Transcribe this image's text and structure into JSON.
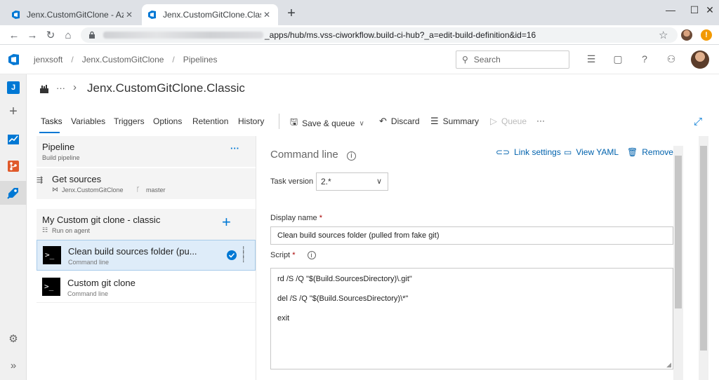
{
  "browser": {
    "tabs": [
      {
        "title": "Jenx.CustomGitClone - Azure De",
        "active": false
      },
      {
        "title": "Jenx.CustomGitClone.Classic - Az",
        "active": true
      }
    ],
    "new_tab": "+",
    "window_controls": {
      "minimize": "—",
      "maximize": "☐",
      "close": "✕"
    },
    "url_path": "_apps/hub/ms.vss-ciworkflow.build-ci-hub?_a=edit-build-definition&id=16",
    "warning_badge": "!"
  },
  "header": {
    "breadcrumbs": [
      "jenxsoft",
      "Jenx.CustomGitClone",
      "Pipelines"
    ],
    "separator": "/",
    "search_placeholder": "Search"
  },
  "rail": {
    "project_initial": "J"
  },
  "page": {
    "title": "Jenx.CustomGitClone.Classic",
    "more": "···",
    "chevron": "›"
  },
  "tabs": [
    "Tasks",
    "Variables",
    "Triggers",
    "Options",
    "Retention",
    "History"
  ],
  "toolbar": {
    "save_queue": "Save & queue",
    "discard": "Discard",
    "summary": "Summary",
    "queue": "Queue",
    "more": "···"
  },
  "pipeline": {
    "title": "Pipeline",
    "subtitle": "Build pipeline",
    "more": "···",
    "get_sources": {
      "title": "Get sources",
      "repo": "Jenx.CustomGitClone",
      "branch": "master"
    },
    "agent_job": {
      "title": "My Custom git clone - classic",
      "subtitle": "Run on agent",
      "add": "+"
    },
    "tasks": [
      {
        "name": "Clean build sources folder (pu...",
        "type": "Command line",
        "selected": true
      },
      {
        "name": "Custom git clone",
        "type": "Command line",
        "selected": false
      }
    ]
  },
  "details": {
    "title": "Command line",
    "links": {
      "link_settings": "Link settings",
      "view_yaml": "View YAML",
      "remove": "Remove"
    },
    "task_version_label": "Task version",
    "task_version_value": "2.*",
    "display_name_label": "Display name",
    "display_name_value": "Clean build sources folder (pulled from fake git)",
    "script_label": "Script",
    "required_mark": "*",
    "script_lines": [
      "rd /S /Q \"$(Build.SourcesDirectory)\\.git\"",
      "del /S /Q \"$(Build.SourcesDirectory)\\*\"",
      "exit"
    ]
  },
  "colors": {
    "accent": "#0078d4",
    "selected_row": "#deecf9",
    "link": "#0062ad"
  }
}
